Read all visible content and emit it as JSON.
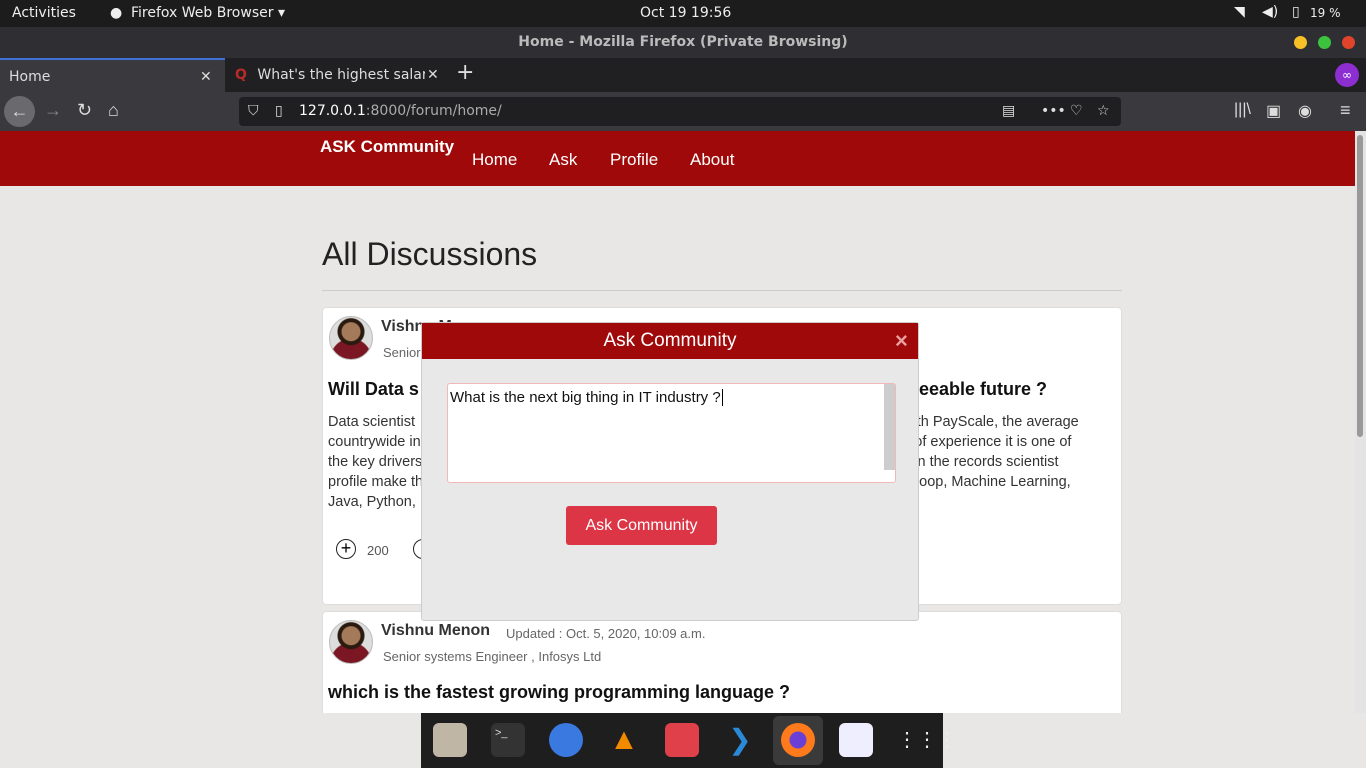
{
  "system": {
    "activities": "Activities",
    "app": "Firefox Web Browser",
    "clock": "Oct 19  19:56",
    "battery": "19 %"
  },
  "window": {
    "title": "Home - Mozilla Firefox (Private Browsing)"
  },
  "tabs": [
    {
      "label": "Home"
    },
    {
      "label": "What's the highest salary"
    }
  ],
  "url": {
    "host": "127.0.0.1",
    "rest": ":8000/forum/home/"
  },
  "site": {
    "brand": "ASK Community",
    "nav": [
      "Home",
      "Ask",
      "Profile",
      "About"
    ],
    "heading": "All Discussions"
  },
  "posts": [
    {
      "author": "Vishnu Menon",
      "role": "Senior",
      "title_left": "Will Data s",
      "title_right": "eeable future ?",
      "body_left": [
        "Data scientist",
        "countrywide in",
        "the key drivers",
        "profile make th",
        "Java, Python,"
      ],
      "body_right": [
        "with PayScale, the average",
        "s of experience it is one of",
        "s in the records scientist",
        "adoop, Machine Learning,",
        ""
      ],
      "upvotes": "200"
    },
    {
      "author": "Vishnu Menon",
      "updated": "Updated : Oct. 5, 2020, 10:09 a.m.",
      "role": "Senior systems Engineer , Infosys Ltd",
      "title": "which is the fastest growing programming language ?"
    }
  ],
  "modal": {
    "title": "Ask Community",
    "close": "×",
    "question": "What is the next big thing in IT industry ?",
    "submit": "Ask Community"
  }
}
